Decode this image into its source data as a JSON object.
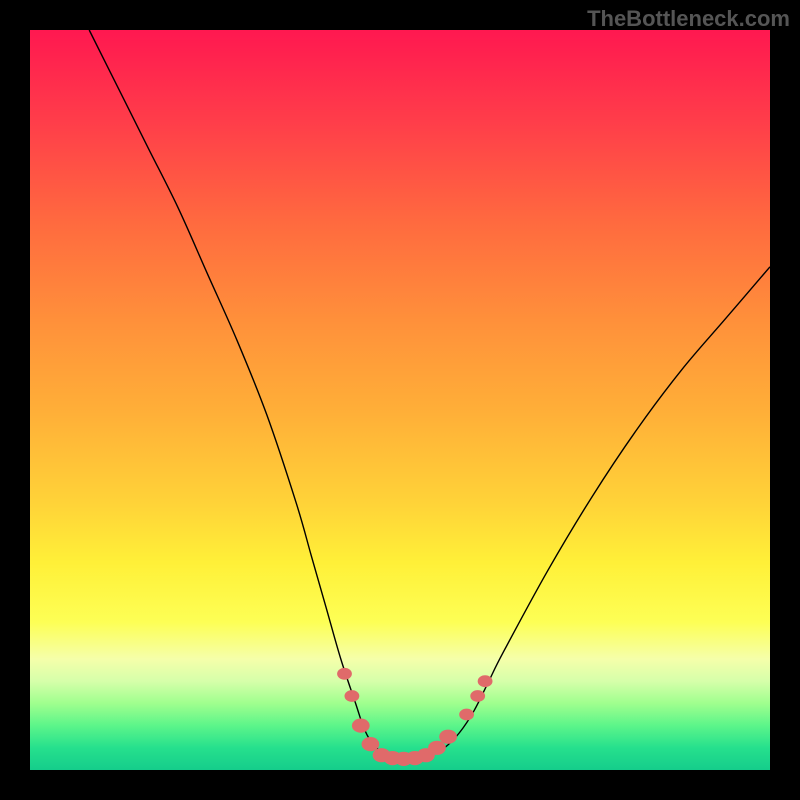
{
  "watermark": "TheBottleneck.com",
  "chart_data": {
    "type": "line",
    "title": "",
    "xlabel": "",
    "ylabel": "",
    "xlim": [
      0,
      100
    ],
    "ylim": [
      0,
      100
    ],
    "grid": false,
    "legend": false,
    "series": [
      {
        "name": "curve",
        "color": "#000000",
        "x": [
          8,
          12,
          16,
          20,
          24,
          28,
          32,
          36,
          38,
          40,
          42,
          44,
          45,
          46,
          48,
          50,
          52,
          54,
          56,
          58,
          60,
          62,
          64,
          70,
          76,
          82,
          88,
          94,
          100
        ],
        "y": [
          100,
          92,
          84,
          76,
          67,
          58,
          48,
          36,
          29,
          22,
          15,
          9,
          6,
          4,
          2,
          1.5,
          1.5,
          2,
          3,
          5,
          8,
          12,
          16,
          27,
          37,
          46,
          54,
          61,
          68
        ]
      }
    ],
    "markers": {
      "name": "highlight-points",
      "color": "#e06a6a",
      "points": [
        {
          "x": 42.5,
          "y": 13,
          "r": 1.0
        },
        {
          "x": 43.5,
          "y": 10,
          "r": 1.0
        },
        {
          "x": 44.7,
          "y": 6,
          "r": 1.2
        },
        {
          "x": 46.0,
          "y": 3.5,
          "r": 1.2
        },
        {
          "x": 47.5,
          "y": 2.0,
          "r": 1.2
        },
        {
          "x": 49.0,
          "y": 1.6,
          "r": 1.2
        },
        {
          "x": 50.5,
          "y": 1.5,
          "r": 1.2
        },
        {
          "x": 52.0,
          "y": 1.6,
          "r": 1.2
        },
        {
          "x": 53.5,
          "y": 2.0,
          "r": 1.2
        },
        {
          "x": 55.0,
          "y": 3.0,
          "r": 1.2
        },
        {
          "x": 56.5,
          "y": 4.5,
          "r": 1.2
        },
        {
          "x": 59.0,
          "y": 7.5,
          "r": 1.0
        },
        {
          "x": 60.5,
          "y": 10,
          "r": 1.0
        },
        {
          "x": 61.5,
          "y": 12,
          "r": 1.0
        }
      ]
    }
  }
}
